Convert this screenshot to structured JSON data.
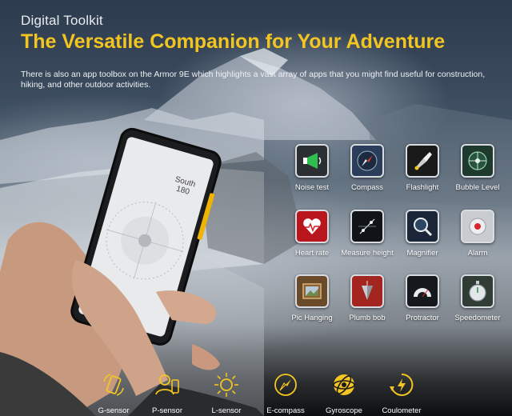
{
  "header": {
    "eyebrow": "Digital Toolkit",
    "title": "The Versatile Companion for Your Adventure",
    "description": "There is also an app toolbox on the Armor 9E which highlights a vast array of apps that you might find useful for construction, hiking, and other outdoor activities."
  },
  "phone_screen": {
    "heading": "South",
    "value": "180"
  },
  "apps": [
    {
      "label": "Noise test",
      "icon": "megaphone-icon"
    },
    {
      "label": "Compass",
      "icon": "compass-icon"
    },
    {
      "label": "Flashlight",
      "icon": "flashlight-icon"
    },
    {
      "label": "Bubble Level",
      "icon": "bubble-level-icon"
    },
    {
      "label": "Heart rate",
      "icon": "heart-icon"
    },
    {
      "label": "Measure height",
      "icon": "measure-height-icon"
    },
    {
      "label": "Magnifier",
      "icon": "magnifier-icon"
    },
    {
      "label": "Alarm",
      "icon": "alarm-icon"
    },
    {
      "label": "Pic Hanging",
      "icon": "picture-frame-icon"
    },
    {
      "label": "Plumb bob",
      "icon": "plumb-bob-icon"
    },
    {
      "label": "Protractor",
      "icon": "protractor-icon"
    },
    {
      "label": "Speedometer",
      "icon": "stopwatch-icon"
    }
  ],
  "sensors": [
    {
      "label": "G-sensor",
      "icon": "g-sensor-icon"
    },
    {
      "label": "P-sensor",
      "icon": "p-sensor-icon"
    },
    {
      "label": "L-sensor",
      "icon": "sun-icon"
    },
    {
      "label": "E-compass",
      "icon": "e-compass-icon"
    },
    {
      "label": "Gyroscope",
      "icon": "gyroscope-icon"
    },
    {
      "label": "Coulometer",
      "icon": "coulometer-icon"
    }
  ],
  "colors": {
    "accent": "#f3c520",
    "text": "#ffffff"
  }
}
